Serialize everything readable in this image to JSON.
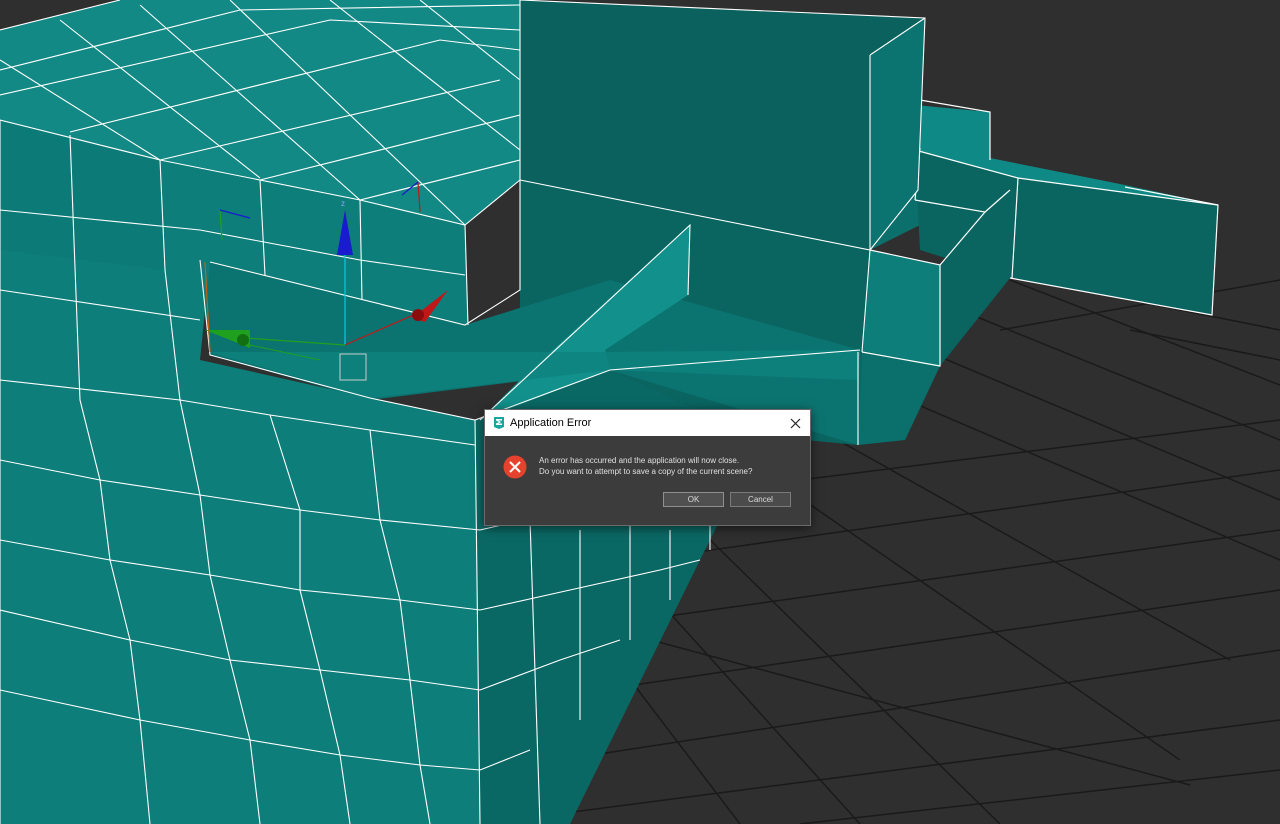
{
  "viewport": {
    "background_color": "#2f2f2f",
    "model_color": "#0d7e7a",
    "wire_color": "#ffffff",
    "gizmo": {
      "z_axis_label": "z",
      "x_axis_color": "#c01818",
      "y_axis_color": "#1fa01f",
      "z_axis_color": "#1a1acf"
    }
  },
  "dialog": {
    "title": "Application Error",
    "icon": "app-icon",
    "error_icon": "error-icon",
    "message_line1": "An error has occurred and the application will now close.",
    "message_line2": "Do you want to attempt to save a copy of the current scene?",
    "ok_label": "OK",
    "cancel_label": "Cancel",
    "close_icon": "close-icon"
  }
}
